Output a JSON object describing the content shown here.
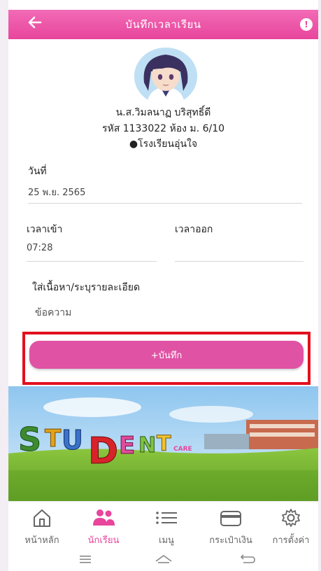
{
  "header": {
    "title": "บันทึกเวลาเรียน",
    "back_icon": "arrow-left-icon",
    "info_icon": "info-icon",
    "color": "#e8459c"
  },
  "profile": {
    "name": "น.ส.วิมลนาฏ บริสุทธิ์ดี",
    "id_line": "รหัส 1133022 ห้อง ม. 6/10",
    "school": "●โรงเรียนอุ่นใจ"
  },
  "form": {
    "date_label": "วันที่",
    "date_value": "25 พ.ย. 2565",
    "time_in_label": "เวลาเข้า",
    "time_in_value": "07:28",
    "time_out_label": "เวลาออก",
    "time_out_value": "",
    "detail_label": "ใส่เนื้อหา/ระบุรายละเอียด",
    "detail_placeholder": "ข้อความ",
    "save_label": "+บันทึก"
  },
  "banner": {
    "logo_text": "STUDENT",
    "logo_sub": "CARE"
  },
  "nav": {
    "items": [
      {
        "label": "หน้าหลัก",
        "icon": "home-icon"
      },
      {
        "label": "นักเรียน",
        "icon": "students-icon"
      },
      {
        "label": "เมนู",
        "icon": "menu-list-icon"
      },
      {
        "label": "กระเป๋าเงิน",
        "icon": "wallet-icon"
      },
      {
        "label": "การตั้งค่า",
        "icon": "gear-icon"
      }
    ],
    "active_index": 1,
    "active_color": "#e8459c"
  }
}
